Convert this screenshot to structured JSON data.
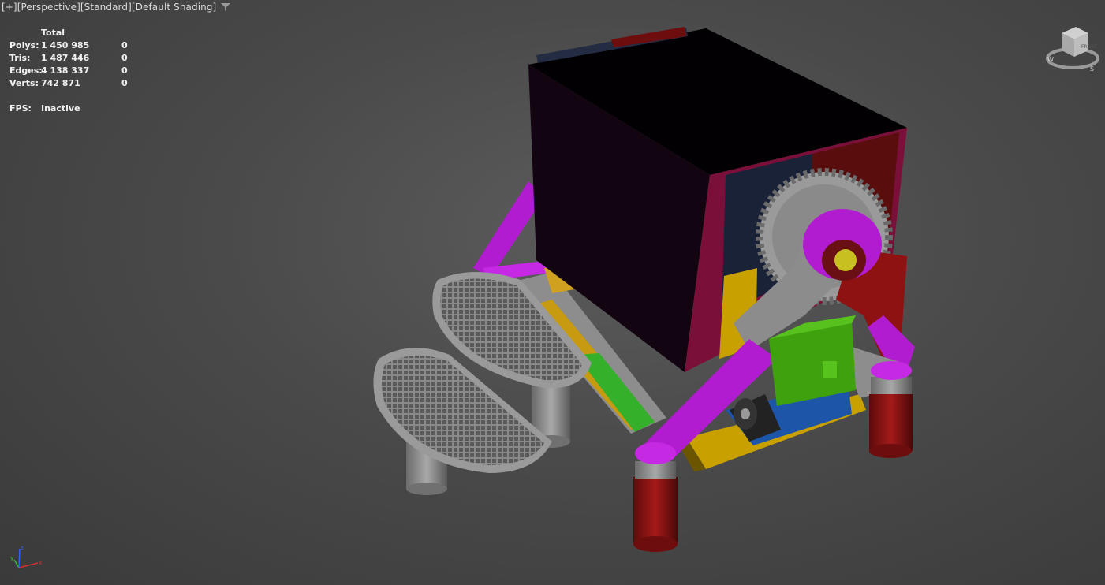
{
  "viewport": {
    "labels": [
      "[+]",
      "[Perspective]",
      "[Standard]",
      "[Default Shading]"
    ],
    "filter_icon": "filter-icon"
  },
  "stats": {
    "header": "Total",
    "rows": [
      {
        "key": "Polys:",
        "total": "1 450 985",
        "sel": "0"
      },
      {
        "key": "Tris:",
        "total": "1 487 446",
        "sel": "0"
      },
      {
        "key": "Edges:",
        "total": "4 138 337",
        "sel": "0"
      },
      {
        "key": "Verts:",
        "total": "742 871",
        "sel": "0"
      }
    ],
    "fps_key": "FPS:",
    "fps_value": "Inactive"
  },
  "viewcube": {
    "face": "FRONT",
    "top": "TOP",
    "compass": [
      "W",
      "S"
    ]
  },
  "axis_tripod": {
    "x": "x",
    "y": "y",
    "z": "z"
  },
  "colors": {
    "frame_magenta": "#b21cd1",
    "leg_red": "#8e1212",
    "gear_gray": "#9a9a9a",
    "box_black": "#080006",
    "plate_yellow": "#c8a000",
    "motor_green": "#3fa10e",
    "mount_blue": "#1d56a8"
  }
}
